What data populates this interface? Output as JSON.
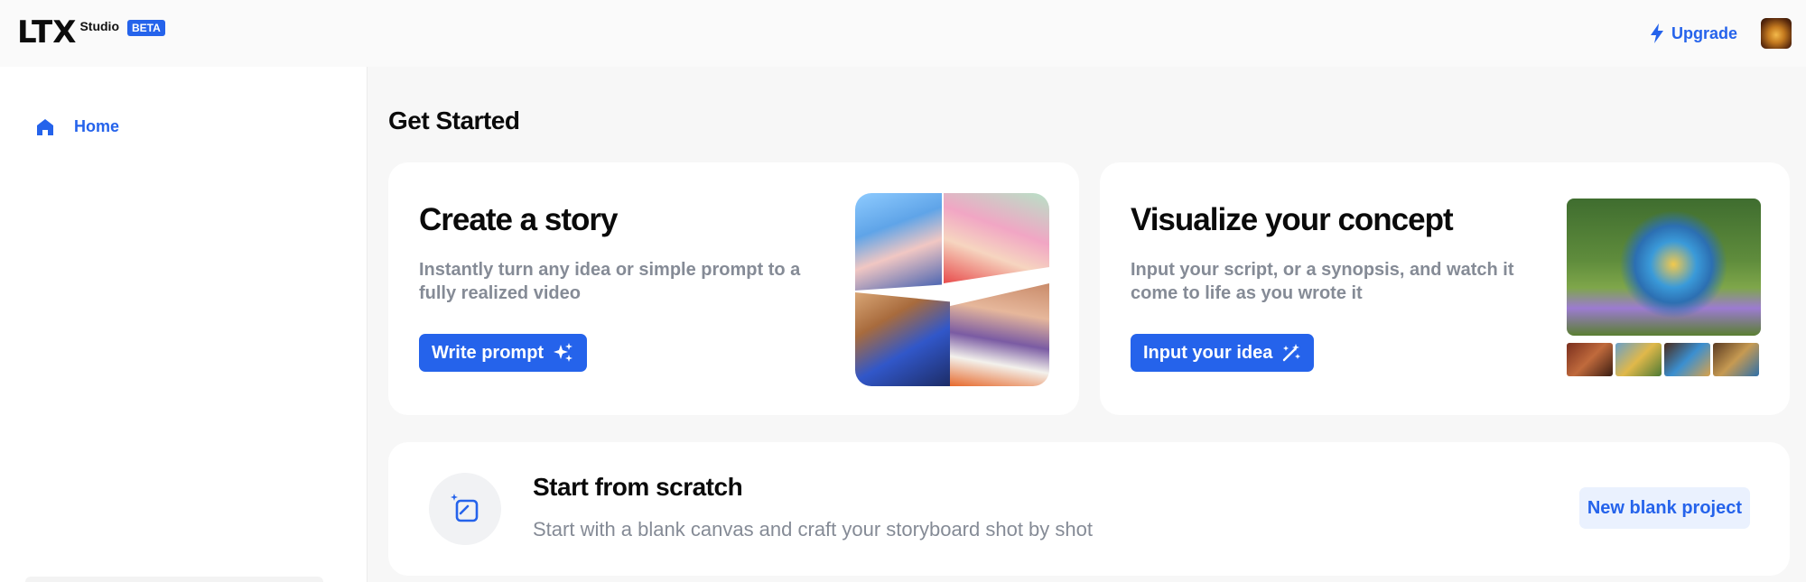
{
  "header": {
    "logo": "LTX",
    "logo_sub": "Studio",
    "badge": "BETA",
    "upgrade_label": "Upgrade",
    "upgrade_icon": "lightning-icon",
    "avatar": "user-avatar"
  },
  "sidebar": {
    "items": [
      {
        "label": "Home",
        "icon": "home-icon",
        "active": true
      }
    ]
  },
  "main": {
    "title": "Get Started",
    "cards": [
      {
        "title": "Create a story",
        "description": "Instantly turn any idea or simple prompt to a fully realized video",
        "button_label": "Write prompt",
        "button_icon": "sparkles-icon"
      },
      {
        "title": "Visualize your concept",
        "description": "Input your script, or a synopsis, and watch it come to life as you wrote it",
        "button_label": "Input your idea",
        "button_icon": "magic-wand-icon"
      }
    ],
    "scratch": {
      "title": "Start from scratch",
      "description": "Start with a blank canvas and craft your storyboard shot by shot",
      "button_label": "New blank project",
      "icon": "blank-canvas-icon"
    }
  },
  "colors": {
    "accent": "#2563eb",
    "muted_text": "#858b96",
    "background": "#f7f7f7"
  }
}
